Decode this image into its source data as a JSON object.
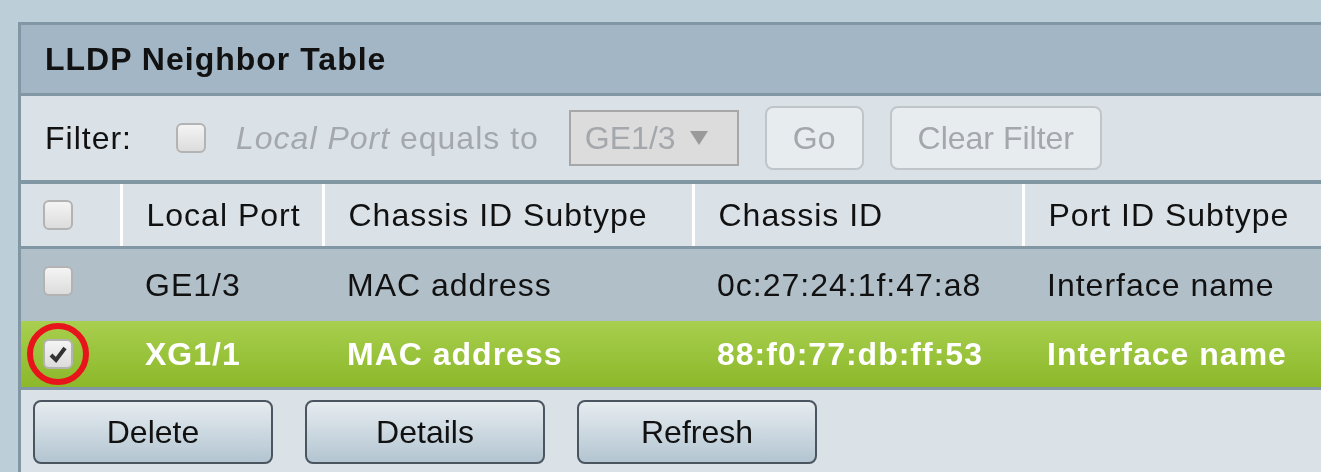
{
  "panel": {
    "title": "LLDP Neighbor Table"
  },
  "filter": {
    "label": "Filter:",
    "checked": false,
    "condition_field": "Local Port",
    "condition_text": "equals to",
    "port": "GE1/3",
    "disabled": true,
    "buttons": [
      "Go",
      "Clear Filter"
    ]
  },
  "table": {
    "select_all_checked": false,
    "columns": [
      "Local Port",
      "Chassis ID Subtype",
      "Chassis ID",
      "Port ID Subtype"
    ],
    "rows": [
      {
        "selected": false,
        "cells": [
          "GE1/3",
          "MAC address",
          "0c:27:24:1f:47:a8",
          "Interface name"
        ]
      },
      {
        "selected": true,
        "highlighted": true,
        "cells": [
          "XG1/1",
          "MAC address",
          "88:f0:77:db:ff:53",
          "Interface name"
        ]
      }
    ]
  },
  "buttons": [
    "Delete",
    "Details",
    "Refresh"
  ]
}
